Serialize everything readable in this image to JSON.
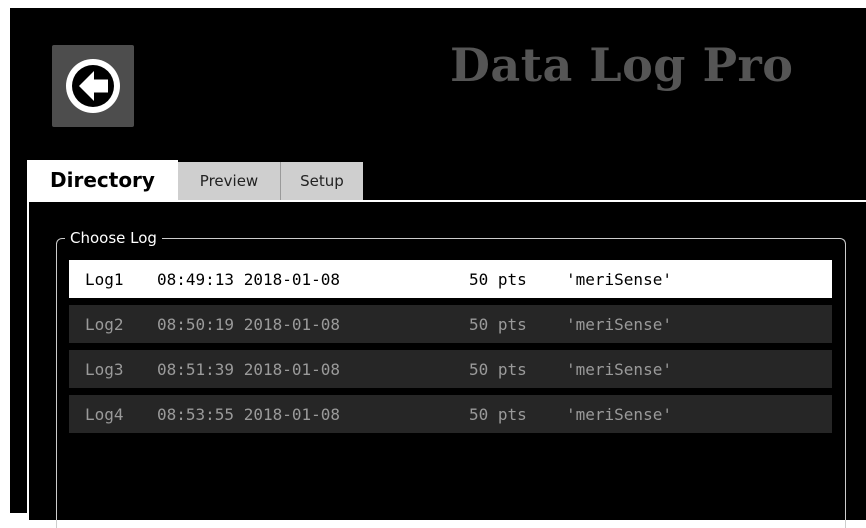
{
  "app": {
    "title": "Data Log Pro"
  },
  "header": {
    "back_icon": "arrow-left-circle-icon"
  },
  "tabs": [
    {
      "label": "Directory",
      "active": true
    },
    {
      "label": "Preview",
      "active": false
    },
    {
      "label": "Setup",
      "active": false
    }
  ],
  "directory": {
    "group_label": "Choose Log",
    "logs": [
      {
        "name": "Log1",
        "timestamp": "08:49:13 2018-01-08",
        "points": "50 pts",
        "source": "'meriSense'",
        "selected": true
      },
      {
        "name": "Log2",
        "timestamp": "08:50:19 2018-01-08",
        "points": "50 pts",
        "source": "'meriSense'",
        "selected": false
      },
      {
        "name": "Log3",
        "timestamp": "08:51:39 2018-01-08",
        "points": "50 pts",
        "source": "'meriSense'",
        "selected": false
      },
      {
        "name": "Log4",
        "timestamp": "08:53:55 2018-01-08",
        "points": "50 pts",
        "source": "'meriSense'",
        "selected": false
      }
    ]
  },
  "colors": {
    "background": "#000000",
    "title": "#555555",
    "back_button": "#4d4d4d",
    "selected_row": "#ffffff",
    "row": "#262626",
    "row_text": "#9a9a9a",
    "inactive_tab": "#cfcfcf"
  }
}
